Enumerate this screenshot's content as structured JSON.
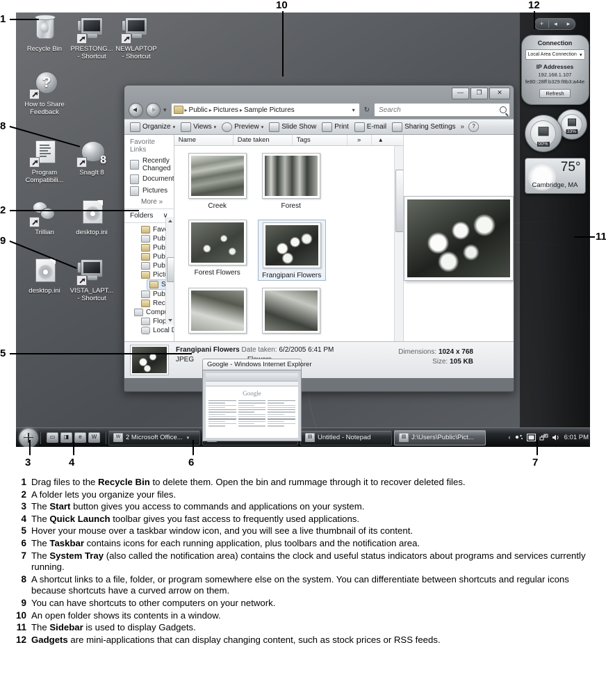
{
  "desktop": {
    "icons": [
      {
        "name": "Recycle Bin",
        "icon": "recycle-bin-icon",
        "shortcut": false
      },
      {
        "name": "PRESTONG...",
        "name2": "- Shortcut",
        "icon": "computer-shortcut-icon",
        "shortcut": true
      },
      {
        "name": "NEWLAPTOP",
        "name2": "- Shortcut",
        "icon": "computer-shortcut-icon",
        "shortcut": true
      },
      {
        "name": "How to Share",
        "name2": "Feedback",
        "icon": "help-question-icon",
        "shortcut": true
      },
      {
        "name": "Program",
        "name2": "Compatibili...",
        "icon": "document-list-icon",
        "shortcut": true
      },
      {
        "name": "SnagIt 8",
        "icon": "snagit-helmet-icon",
        "shortcut": true
      },
      {
        "name": "Trillian",
        "icon": "trillian-icon",
        "shortcut": true
      },
      {
        "name": "desktop.ini",
        "icon": "gear-document-icon",
        "shortcut": false
      },
      {
        "name": "desktop.ini",
        "icon": "gear-document-icon",
        "shortcut": false
      },
      {
        "name": "VISTA_LAPT...",
        "name2": "- Shortcut",
        "icon": "computer-shortcut-icon",
        "shortcut": true
      }
    ]
  },
  "explorer": {
    "window_buttons": {
      "minimize": "—",
      "maximize": "❐",
      "close": "✕"
    },
    "address": {
      "crumbs": [
        "Public",
        "Pictures",
        "Sample Pictures"
      ],
      "separator": "▸",
      "dropdown_caret": "▾",
      "refresh_icon": "refresh-icon",
      "refresh_glyph": "↻"
    },
    "search": {
      "placeholder": "Search",
      "icon": "search-icon"
    },
    "toolbar": [
      {
        "label": "Organize",
        "icon": "organize-icon",
        "caret": true
      },
      {
        "label": "Views",
        "icon": "views-icon",
        "caret": true
      },
      {
        "label": "Preview",
        "icon": "preview-icon",
        "caret": true
      },
      {
        "label": "Slide Show",
        "icon": "slideshow-icon",
        "caret": false
      },
      {
        "label": "Print",
        "icon": "print-icon",
        "caret": false
      },
      {
        "label": "E-mail",
        "icon": "email-icon",
        "caret": false
      },
      {
        "label": "Sharing Settings",
        "icon": "sharing-icon",
        "caret": false
      }
    ],
    "toolbar_overflow": "»",
    "toolbar_help": "?",
    "nav": {
      "favorite_links_header": "Favorite Links",
      "links": [
        "Recently Changed",
        "Documents",
        "Pictures"
      ],
      "more_label": "More",
      "more_glyph": "»",
      "folders_header": "Folders",
      "folders_caret": "∨",
      "tree": [
        {
          "label": "Favorites",
          "indent": 1,
          "selected": false,
          "icon": "folder-icon"
        },
        {
          "label": "Public Desktop",
          "indent": 1,
          "selected": false,
          "icon": "folder-icon"
        },
        {
          "label": "Public Documents",
          "indent": 1,
          "selected": false,
          "icon": "folder-icon"
        },
        {
          "label": "Public Downloads",
          "indent": 1,
          "selected": false,
          "icon": "folder-icon"
        },
        {
          "label": "Public Music",
          "indent": 1,
          "selected": false,
          "icon": "folder-music-icon"
        },
        {
          "label": "Pictures",
          "indent": 1,
          "selected": false,
          "icon": "folder-icon"
        },
        {
          "label": "Sample Pictures",
          "indent": 2,
          "selected": true,
          "icon": "folder-icon"
        },
        {
          "label": "Public Videos",
          "indent": 1,
          "selected": false,
          "icon": "folder-video-icon"
        },
        {
          "label": "Recorded TV",
          "indent": 1,
          "selected": false,
          "icon": "folder-icon"
        },
        {
          "label": "Computer",
          "indent": 0,
          "selected": false,
          "icon": "computer-icon"
        },
        {
          "label": "Floppy Disk Drive (",
          "indent": 1,
          "selected": false,
          "icon": "floppy-icon"
        },
        {
          "label": "Local Disk (C:)",
          "indent": 1,
          "selected": false,
          "icon": "disk-icon"
        }
      ]
    },
    "columns": [
      "Name",
      "Date taken",
      "Tags"
    ],
    "column_overflow": "»",
    "column_sort": "▴",
    "files": [
      {
        "name": "Creek",
        "selected": false
      },
      {
        "name": "Forest",
        "selected": false
      },
      {
        "name": "Forest Flowers",
        "selected": false
      },
      {
        "name": "Frangipani Flowers",
        "selected": true
      },
      {
        "name": "",
        "selected": false
      },
      {
        "name": "",
        "selected": false
      }
    ],
    "details": {
      "title": "Frangipani Flowers",
      "date_label": "Date taken:",
      "date_value": "6/2/2005 6:41 PM",
      "type": "JPEG",
      "tag_partial": "Flowers",
      "dimensions_label": "Dimensions:",
      "dimensions_value": "1024 x 768",
      "size_label": "Size:",
      "size_value": "105 KB",
      "rating": "☆☆☆"
    }
  },
  "live_thumbnail": {
    "title": "Google - Windows Internet Explorer",
    "page_logo": "Google"
  },
  "sidebar": {
    "controls": {
      "add": "+",
      "prev": "◂",
      "next": "▸"
    },
    "network_gadget": {
      "title": "Connection",
      "selected_connection": "Local Area Connection",
      "caret": "▾",
      "ip_header": "IP Addresses",
      "ipv4": "192.168.1.107",
      "ipv6": "fe80::28ff:b329:f8b3:a44e",
      "refresh_button": "Refresh"
    },
    "cpu_gadget": {
      "cpu_percent": "00%",
      "memory_percent": "33%"
    },
    "weather_gadget": {
      "temperature": "75°",
      "location": "Cambridge, MA"
    }
  },
  "taskbar": {
    "start_button": "start-orb",
    "quick_launch": [
      {
        "icon": "show-desktop-icon",
        "glyph": "▭"
      },
      {
        "icon": "flip-3d-icon",
        "glyph": "◨"
      },
      {
        "icon": "internet-explorer-icon",
        "glyph": "e"
      },
      {
        "icon": "word-icon",
        "glyph": "W"
      }
    ],
    "windows": [
      {
        "label": "2 Microsoft Office...",
        "icon": "word-icon",
        "glyph": "W",
        "caret": true,
        "active": false
      },
      {
        "label": "Google - Windows I...",
        "icon": "internet-explorer-icon",
        "glyph": "e",
        "caret": false,
        "active": false
      },
      {
        "label": "Untitled - Notepad",
        "icon": "notepad-icon",
        "glyph": "▤",
        "caret": false,
        "active": false
      },
      {
        "label": "J:\\Users\\Public\\Pict...",
        "icon": "folder-icon",
        "glyph": "▧",
        "caret": false,
        "active": true
      }
    ],
    "tray": {
      "overflow": "‹",
      "icons": [
        "network-icon",
        "volume-icon",
        "action-center-icon"
      ],
      "clock": "6:01 PM"
    }
  },
  "callouts": [
    {
      "num": "1"
    },
    {
      "num": "2"
    },
    {
      "num": "3"
    },
    {
      "num": "4"
    },
    {
      "num": "5"
    },
    {
      "num": "6"
    },
    {
      "num": "7"
    },
    {
      "num": "8"
    },
    {
      "num": "9"
    },
    {
      "num": "10"
    },
    {
      "num": "11"
    },
    {
      "num": "12"
    }
  ],
  "captions": [
    {
      "num": "1",
      "parts": [
        {
          "t": "Drag files to the ",
          "b": false
        },
        {
          "t": "Recycle Bin",
          "b": true
        },
        {
          "t": " to delete them. Open the bin and rummage through it to recover deleted files.",
          "b": false
        }
      ]
    },
    {
      "num": "2",
      "parts": [
        {
          "t": "A folder lets you organize your files.",
          "b": false
        }
      ]
    },
    {
      "num": "3",
      "parts": [
        {
          "t": "The ",
          "b": false
        },
        {
          "t": "Start",
          "b": true
        },
        {
          "t": " button gives you access to commands and applications on your system.",
          "b": false
        }
      ]
    },
    {
      "num": "4",
      "parts": [
        {
          "t": "The ",
          "b": false
        },
        {
          "t": "Quick Launch",
          "b": true
        },
        {
          "t": " toolbar gives you fast access to frequently used applications.",
          "b": false
        }
      ]
    },
    {
      "num": "5",
      "parts": [
        {
          "t": "Hover your mouse over a taskbar window icon, and you will see a live thumbnail of its content.",
          "b": false
        }
      ]
    },
    {
      "num": "6",
      "parts": [
        {
          "t": "The ",
          "b": false
        },
        {
          "t": "Taskbar",
          "b": true
        },
        {
          "t": " contains icons for each running application, plus toolbars and the notification area.",
          "b": false
        }
      ]
    },
    {
      "num": "7",
      "parts": [
        {
          "t": "The ",
          "b": false
        },
        {
          "t": "System Tray",
          "b": true
        },
        {
          "t": " (also called the notification area) contains the clock and useful status indicators about programs and services currently running.",
          "b": false
        }
      ]
    },
    {
      "num": "8",
      "parts": [
        {
          "t": "A shortcut links to a file, folder, or program somewhere else on the system. You can differentiate between shortcuts and regular icons because shortcuts have a curved arrow on them.",
          "b": false
        }
      ]
    },
    {
      "num": "9",
      "parts": [
        {
          "t": "You can have shortcuts to other computers on your network.",
          "b": false
        }
      ]
    },
    {
      "num": "10",
      "parts": [
        {
          "t": "An open folder shows its contents in a window.",
          "b": false
        }
      ]
    },
    {
      "num": "11",
      "parts": [
        {
          "t": "The ",
          "b": false
        },
        {
          "t": "Sidebar",
          "b": true
        },
        {
          "t": " is used to display Gadgets.",
          "b": false
        }
      ]
    },
    {
      "num": "12",
      "parts": [
        {
          "t": "Gadgets",
          "b": true
        },
        {
          "t": " are mini-applications that can display changing content, such as stock prices or RSS feeds.",
          "b": false
        }
      ]
    }
  ]
}
